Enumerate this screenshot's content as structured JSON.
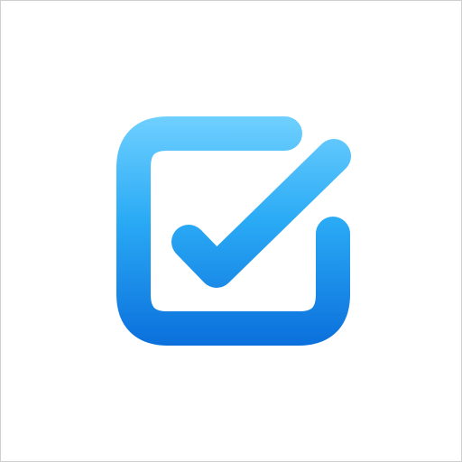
{
  "icon": {
    "name": "checkbox-checked-icon",
    "gradient": {
      "top": "#6FD0FF",
      "middle": "#2AAAF5",
      "bottom": "#0A6EDB"
    },
    "background": "#FFFFFF",
    "border": "#CFCFCF"
  }
}
